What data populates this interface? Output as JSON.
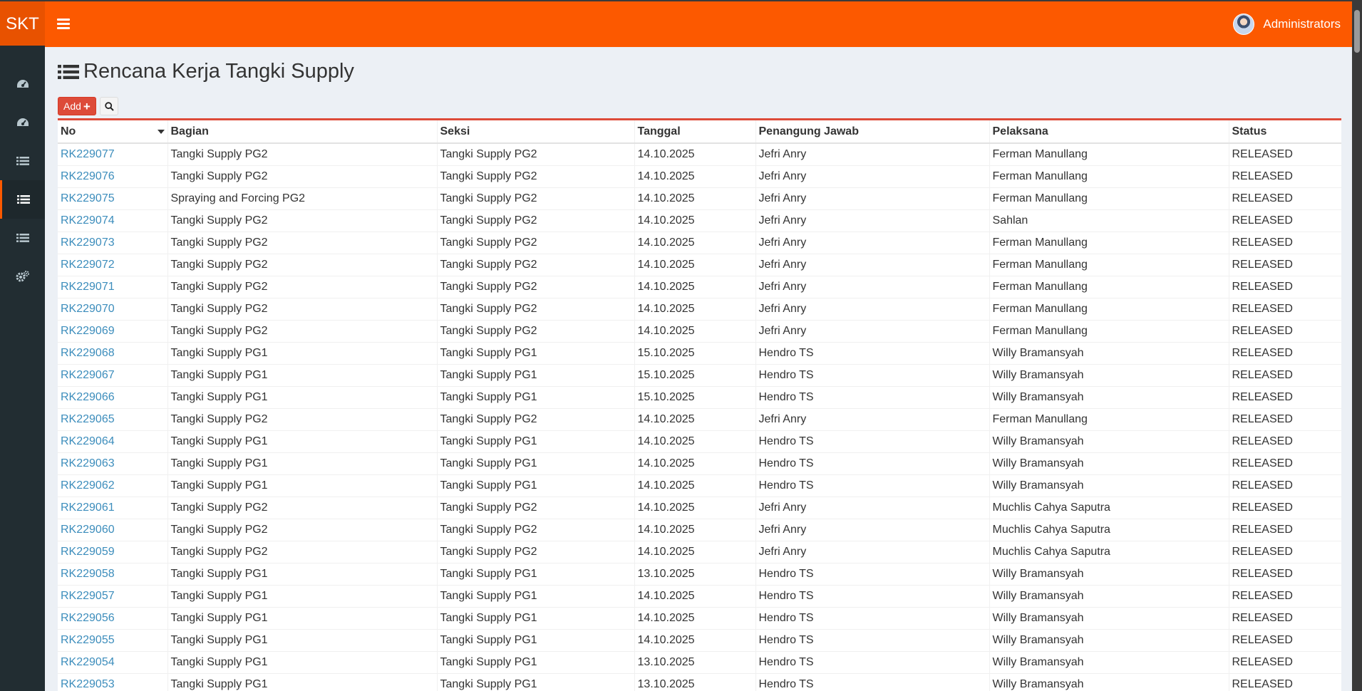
{
  "brand": "SKT",
  "user": {
    "name": "Administrators"
  },
  "page": {
    "title": "Rencana Kerja Tangki Supply"
  },
  "toolbar": {
    "add_label": "Add"
  },
  "sidebar": {
    "icons": [
      "dashboard-icon",
      "dashboard-icon",
      "list-icon",
      "list-icon",
      "list-icon",
      "cogs-icon"
    ],
    "active_index": 3
  },
  "colors": {
    "accent": "#fc5900",
    "sidebar": "#222d32",
    "link": "#3c8dbc",
    "add_button": "#dd4b39"
  },
  "table": {
    "columns": [
      "No",
      "Bagian",
      "Seksi",
      "Tanggal",
      "Penangung Jawab",
      "Pelaksana",
      "Status"
    ],
    "rows": [
      [
        "RK229077",
        "Tangki Supply PG2",
        "Tangki Supply PG2",
        "14.10.2025",
        "Jefri Anry",
        "Ferman Manullang",
        "RELEASED"
      ],
      [
        "RK229076",
        "Tangki Supply PG2",
        "Tangki Supply PG2",
        "14.10.2025",
        "Jefri Anry",
        "Ferman Manullang",
        "RELEASED"
      ],
      [
        "RK229075",
        "Spraying and Forcing PG2",
        "Tangki Supply PG2",
        "14.10.2025",
        "Jefri Anry",
        "Ferman Manullang",
        "RELEASED"
      ],
      [
        "RK229074",
        "Tangki Supply PG2",
        "Tangki Supply PG2",
        "14.10.2025",
        "Jefri Anry",
        "Sahlan",
        "RELEASED"
      ],
      [
        "RK229073",
        "Tangki Supply PG2",
        "Tangki Supply PG2",
        "14.10.2025",
        "Jefri Anry",
        "Ferman Manullang",
        "RELEASED"
      ],
      [
        "RK229072",
        "Tangki Supply PG2",
        "Tangki Supply PG2",
        "14.10.2025",
        "Jefri Anry",
        "Ferman Manullang",
        "RELEASED"
      ],
      [
        "RK229071",
        "Tangki Supply PG2",
        "Tangki Supply PG2",
        "14.10.2025",
        "Jefri Anry",
        "Ferman Manullang",
        "RELEASED"
      ],
      [
        "RK229070",
        "Tangki Supply PG2",
        "Tangki Supply PG2",
        "14.10.2025",
        "Jefri Anry",
        "Ferman Manullang",
        "RELEASED"
      ],
      [
        "RK229069",
        "Tangki Supply PG2",
        "Tangki Supply PG2",
        "14.10.2025",
        "Jefri Anry",
        "Ferman Manullang",
        "RELEASED"
      ],
      [
        "RK229068",
        "Tangki Supply PG1",
        "Tangki Supply PG1",
        "15.10.2025",
        "Hendro TS",
        "Willy Bramansyah",
        "RELEASED"
      ],
      [
        "RK229067",
        "Tangki Supply PG1",
        "Tangki Supply PG1",
        "15.10.2025",
        "Hendro TS",
        "Willy Bramansyah",
        "RELEASED"
      ],
      [
        "RK229066",
        "Tangki Supply PG1",
        "Tangki Supply PG1",
        "15.10.2025",
        "Hendro TS",
        "Willy Bramansyah",
        "RELEASED"
      ],
      [
        "RK229065",
        "Tangki Supply PG2",
        "Tangki Supply PG2",
        "14.10.2025",
        "Jefri Anry",
        "Ferman Manullang",
        "RELEASED"
      ],
      [
        "RK229064",
        "Tangki Supply PG1",
        "Tangki Supply PG1",
        "14.10.2025",
        "Hendro TS",
        "Willy Bramansyah",
        "RELEASED"
      ],
      [
        "RK229063",
        "Tangki Supply PG1",
        "Tangki Supply PG1",
        "14.10.2025",
        "Hendro TS",
        "Willy Bramansyah",
        "RELEASED"
      ],
      [
        "RK229062",
        "Tangki Supply PG1",
        "Tangki Supply PG1",
        "14.10.2025",
        "Hendro TS",
        "Willy Bramansyah",
        "RELEASED"
      ],
      [
        "RK229061",
        "Tangki Supply PG2",
        "Tangki Supply PG2",
        "14.10.2025",
        "Jefri Anry",
        "Muchlis Cahya Saputra",
        "RELEASED"
      ],
      [
        "RK229060",
        "Tangki Supply PG2",
        "Tangki Supply PG2",
        "14.10.2025",
        "Jefri Anry",
        "Muchlis Cahya Saputra",
        "RELEASED"
      ],
      [
        "RK229059",
        "Tangki Supply PG2",
        "Tangki Supply PG2",
        "14.10.2025",
        "Jefri Anry",
        "Muchlis Cahya Saputra",
        "RELEASED"
      ],
      [
        "RK229058",
        "Tangki Supply PG1",
        "Tangki Supply PG1",
        "13.10.2025",
        "Hendro TS",
        "Willy Bramansyah",
        "RELEASED"
      ],
      [
        "RK229057",
        "Tangki Supply PG1",
        "Tangki Supply PG1",
        "14.10.2025",
        "Hendro TS",
        "Willy Bramansyah",
        "RELEASED"
      ],
      [
        "RK229056",
        "Tangki Supply PG1",
        "Tangki Supply PG1",
        "14.10.2025",
        "Hendro TS",
        "Willy Bramansyah",
        "RELEASED"
      ],
      [
        "RK229055",
        "Tangki Supply PG1",
        "Tangki Supply PG1",
        "14.10.2025",
        "Hendro TS",
        "Willy Bramansyah",
        "RELEASED"
      ],
      [
        "RK229054",
        "Tangki Supply PG1",
        "Tangki Supply PG1",
        "13.10.2025",
        "Hendro TS",
        "Willy Bramansyah",
        "RELEASED"
      ],
      [
        "RK229053",
        "Tangki Supply PG1",
        "Tangki Supply PG1",
        "13.10.2025",
        "Hendro TS",
        "Willy Bramansyah",
        "RELEASED"
      ]
    ]
  }
}
